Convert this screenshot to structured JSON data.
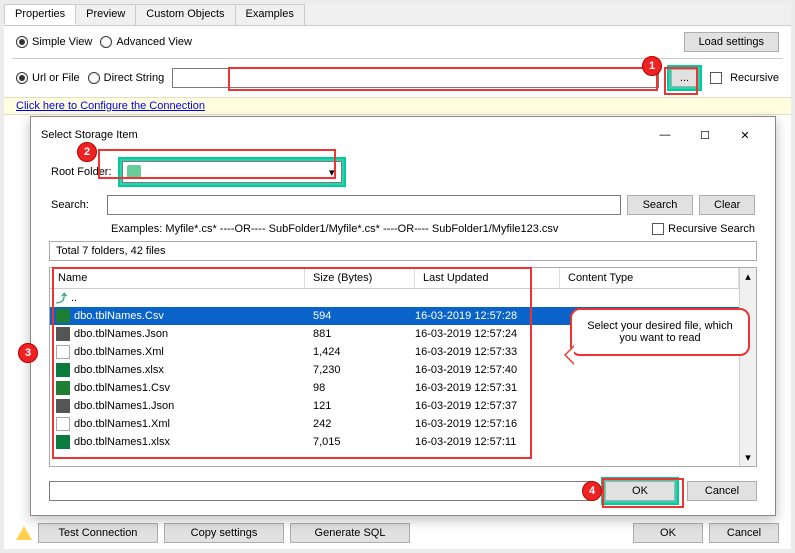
{
  "tabs": [
    "Properties",
    "Preview",
    "Custom Objects",
    "Examples"
  ],
  "active_tab": 0,
  "view": {
    "simple": "Simple View",
    "advanced": "Advanced View"
  },
  "load_settings": "Load settings",
  "src": {
    "url": "Url or File",
    "direct": "Direct String"
  },
  "browse_btn": "...",
  "recursive": "Recursive",
  "configure_link": "Click here to Configure the Connection",
  "dialog": {
    "title": "Select Storage Item",
    "root_folder_label": "Root Folder:",
    "root_folder_value": "",
    "search_label": "Search:",
    "search_btn": "Search",
    "clear_btn": "Clear",
    "examples": "Examples:  Myfile*.cs*   ----OR----   SubFolder1/Myfile*.cs*   ----OR----   SubFolder1/Myfile123.csv",
    "recursive_search": "Recursive Search",
    "status": "Total 7 folders, 42 files",
    "headers": {
      "name": "Name",
      "size": "Size (Bytes)",
      "updated": "Last Updated",
      "content": "Content Type"
    },
    "rows": [
      {
        "ico": "up",
        "name": "..",
        "size": "",
        "date": ""
      },
      {
        "ico": "csv",
        "name": "dbo.tblNames.Csv",
        "size": "594",
        "date": "16-03-2019 12:57:28",
        "sel": true
      },
      {
        "ico": "json",
        "name": "dbo.tblNames.Json",
        "size": "881",
        "date": "16-03-2019 12:57:24"
      },
      {
        "ico": "xml",
        "name": "dbo.tblNames.Xml",
        "size": "1,424",
        "date": "16-03-2019 12:57:33"
      },
      {
        "ico": "xlsx",
        "name": "dbo.tblNames.xlsx",
        "size": "7,230",
        "date": "16-03-2019 12:57:40"
      },
      {
        "ico": "csv",
        "name": "dbo.tblNames1.Csv",
        "size": "98",
        "date": "16-03-2019 12:57:31"
      },
      {
        "ico": "json",
        "name": "dbo.tblNames1.Json",
        "size": "121",
        "date": "16-03-2019 12:57:37"
      },
      {
        "ico": "xml",
        "name": "dbo.tblNames1.Xml",
        "size": "242",
        "date": "16-03-2019 12:57:16"
      },
      {
        "ico": "xlsx",
        "name": "dbo.tblNames1.xlsx",
        "size": "7,015",
        "date": "16-03-2019 12:57:11"
      }
    ],
    "ok": "OK",
    "cancel": "Cancel"
  },
  "callout": "Select your desired file, which you want to read",
  "bottom": {
    "test": "Test Connection",
    "copy": "Copy settings",
    "sql": "Generate SQL",
    "ok": "OK",
    "cancel": "Cancel"
  },
  "badges": {
    "b1": "1",
    "b2": "2",
    "b3": "3",
    "b4": "4"
  }
}
